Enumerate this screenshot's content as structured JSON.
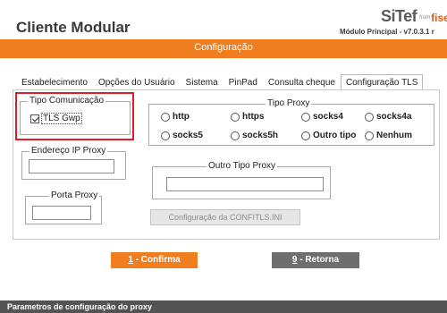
{
  "header": {
    "title": "Cliente Modular",
    "logo_main": "SiTef",
    "logo_from": "from",
    "logo_brand": "fiserv",
    "module_info": "Módulo Principal - v7.0.3.1 r"
  },
  "banner": {
    "title": "Configuração"
  },
  "tabs": [
    {
      "label": "Estabelecimento"
    },
    {
      "label": "Opções do Usuário"
    },
    {
      "label": "Sistema"
    },
    {
      "label": "PinPad"
    },
    {
      "label": "Consulta cheque"
    },
    {
      "label": "Configuração TLS",
      "active": true
    }
  ],
  "tipo_comunicacao": {
    "legend": "Tipo Comunicação",
    "tls_gwp_label": "TLS Gwp",
    "tls_gwp_checked": true
  },
  "tipo_proxy": {
    "legend": "Tipo Proxy",
    "options": [
      "http",
      "https",
      "socks4",
      "socks4a",
      "socks5",
      "socks5h",
      "Outro tipo",
      "Nenhum"
    ]
  },
  "endereco_ip_proxy": {
    "legend": "Endereço IP Proxy",
    "value": ""
  },
  "porta_proxy": {
    "legend": "Porta Proxy",
    "value": ""
  },
  "outro_tipo_proxy": {
    "legend": "Outro Tipo Proxy",
    "value": ""
  },
  "buttons": {
    "confitls": "Configuração da CONFITLS.INI",
    "confirm_key": "1",
    "confirm_label": " - Confirma",
    "return_key": "9",
    "return_label": " - Retorna"
  },
  "status": {
    "text": "Parametros de configuração do proxy"
  },
  "colors": {
    "accent": "#f07d1e",
    "highlight": "#e01b2a",
    "status_bar": "#535353"
  }
}
